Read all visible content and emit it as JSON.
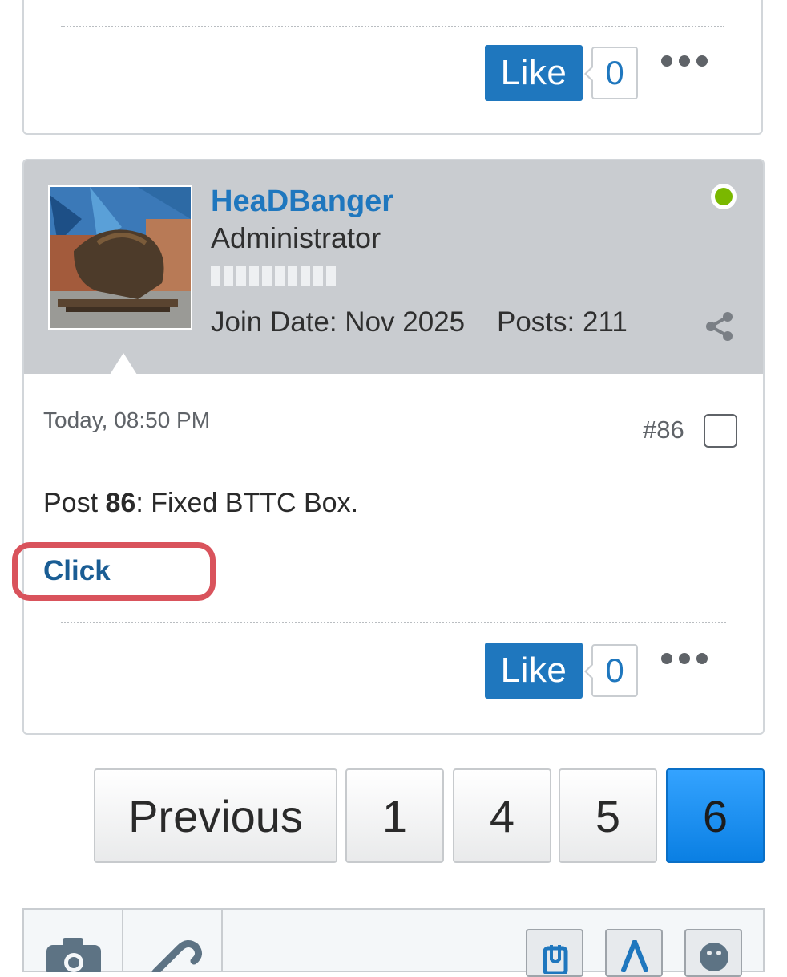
{
  "previous_post": {
    "like_label": "Like",
    "like_count": "0"
  },
  "post": {
    "username": "HeaDBanger",
    "user_title": "Administrator",
    "join_date": "Join Date: Nov 2025",
    "posts": "Posts: 211",
    "timestamp": "Today, 08:50 PM",
    "post_number": "#86",
    "content_prefix": "Post ",
    "content_bold": "86",
    "content_suffix": ": Fixed BTTC Box.",
    "link_text": "Click",
    "like_label": "Like",
    "like_count": "0",
    "online_status_color": "#7ab800"
  },
  "pagination": {
    "previous_label": "Previous",
    "pages": [
      "1",
      "4",
      "5",
      "6"
    ],
    "current_page": "6"
  },
  "colors": {
    "accent": "#1f77be",
    "highlight": "#d9535c",
    "active_page": "#0a7fe3"
  },
  "icons": {
    "online": "online-status-icon",
    "share": "share-icon",
    "more": "more-options-icon",
    "camera": "camera-icon",
    "link": "paperclip-link-icon",
    "attach": "attachment-icon",
    "format": "text-format-icon",
    "emoji": "emoji-icon"
  }
}
